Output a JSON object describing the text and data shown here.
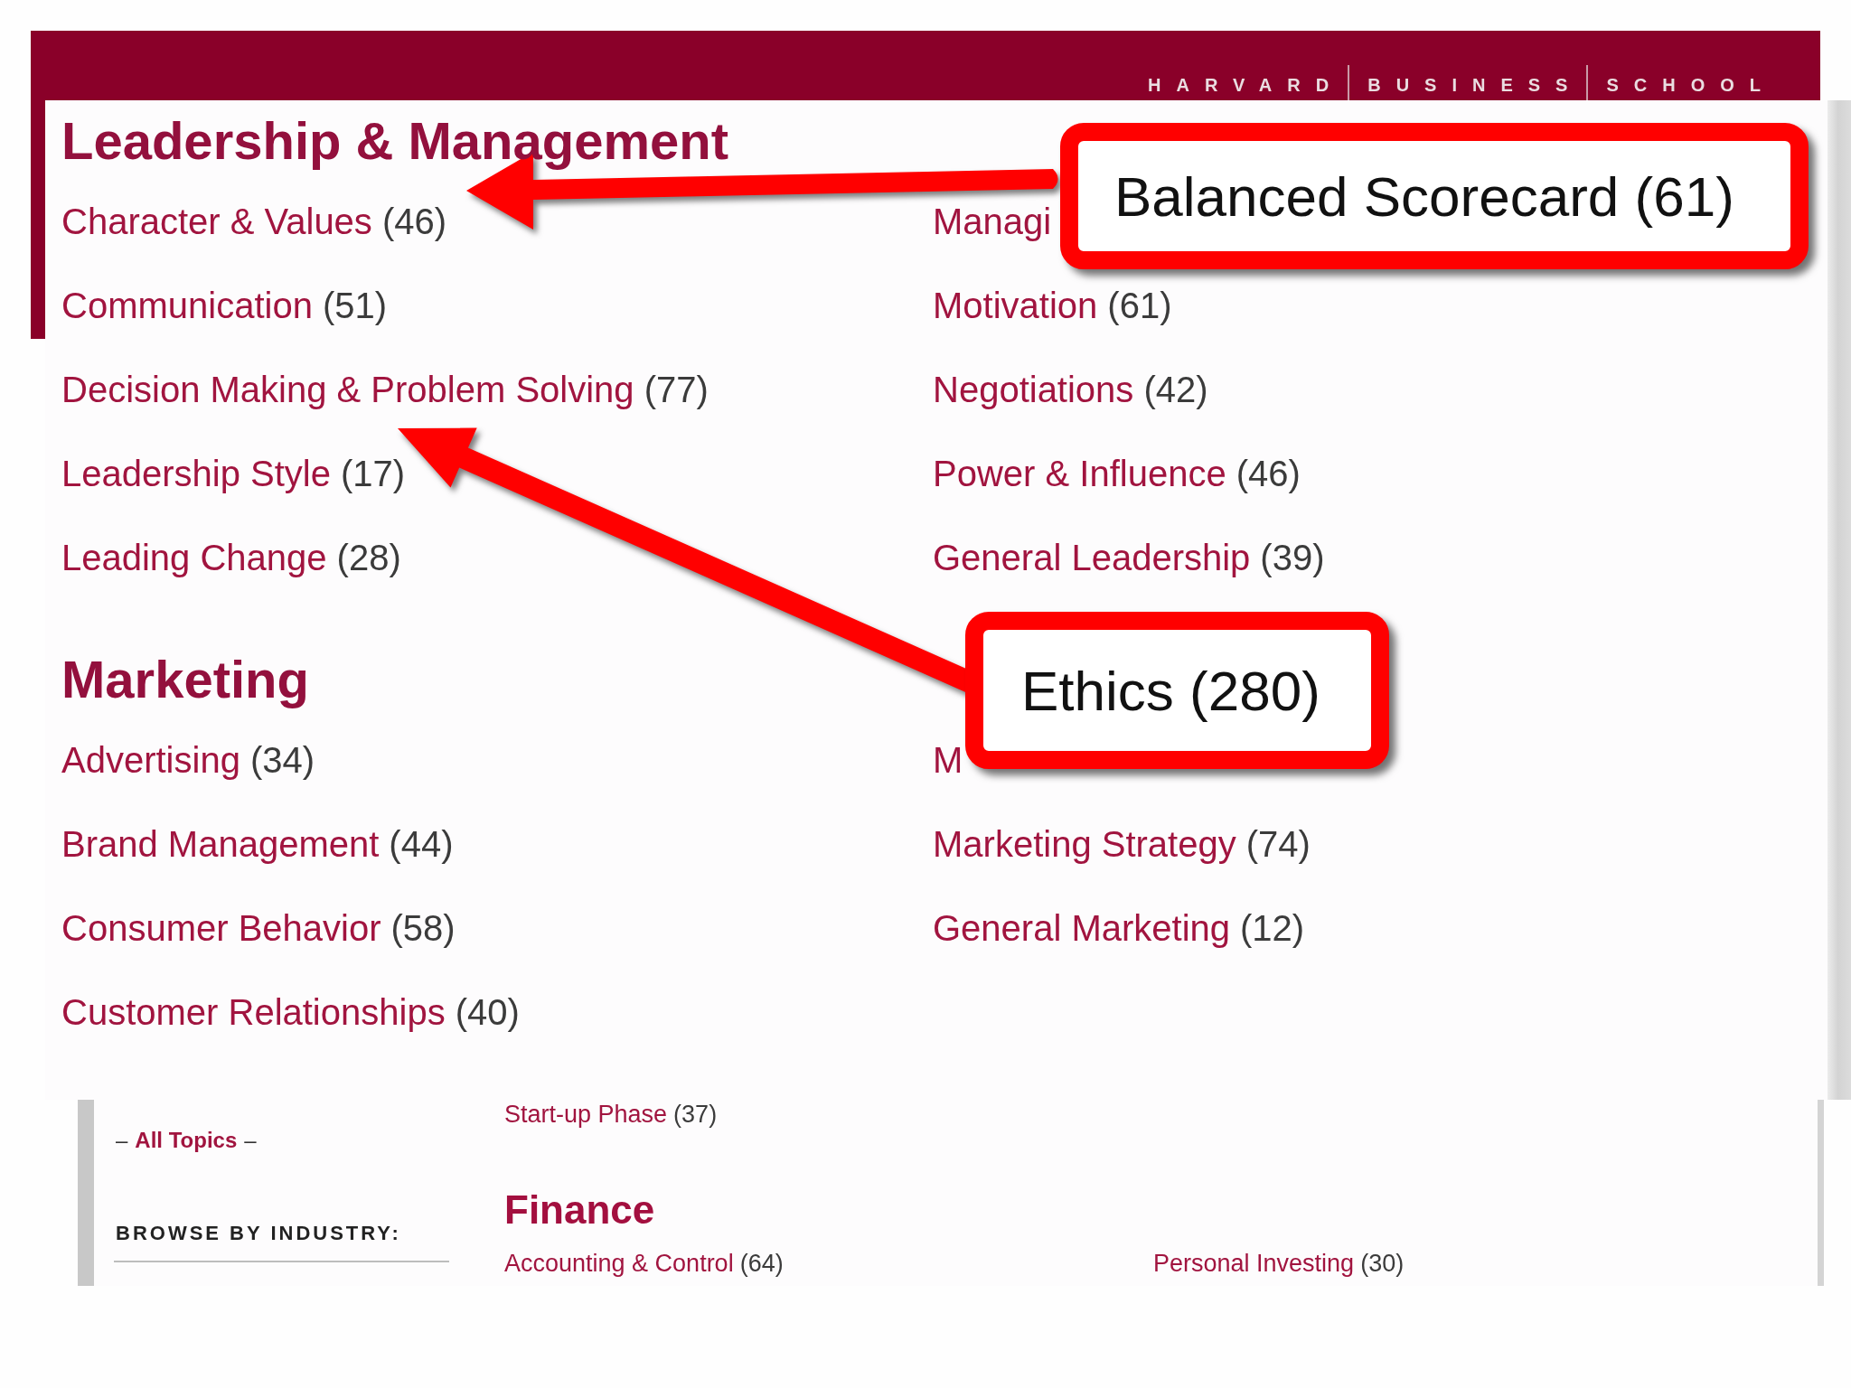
{
  "header": {
    "wordmark": [
      "HARVARD",
      "BUSINESS",
      "SCHOOL"
    ]
  },
  "sections": [
    {
      "title": "Leadership & Management",
      "columns": [
        [
          {
            "label": "Character & Values",
            "count": "(46)"
          },
          {
            "label": "Communication",
            "count": "(51)"
          },
          {
            "label": "Decision Making & Problem Solving",
            "count": "(77)"
          },
          {
            "label": "Leadership Style",
            "count": "(17)"
          },
          {
            "label": "Leading Change",
            "count": "(28)"
          }
        ],
        [
          {
            "label": "Managi"
          },
          {
            "label": "Motivation",
            "count": "(61)"
          },
          {
            "label": "Negotiations",
            "count": "(42)"
          },
          {
            "label": "Power & Influence",
            "count": "(46)"
          },
          {
            "label": "General Leadership",
            "count": "(39)"
          }
        ]
      ]
    },
    {
      "title": "Marketing",
      "columns": [
        [
          {
            "label": "Advertising",
            "count": "(34)"
          },
          {
            "label": "Brand Management",
            "count": "(44)"
          },
          {
            "label": "Consumer Behavior",
            "count": "(58)"
          },
          {
            "label": "Customer Relationships",
            "count": "(40)"
          }
        ],
        [
          {
            "label": "M"
          },
          {
            "label": "Marketing Strategy",
            "count": "(74)"
          },
          {
            "label": "General Marketing",
            "count": "(12)"
          }
        ]
      ]
    }
  ],
  "callouts": [
    {
      "text": "Balanced Scorecard (61)"
    },
    {
      "text": "Ethics (280)"
    }
  ],
  "lower_strip": {
    "sidebar": {
      "all_topics": {
        "before": "–",
        "link": "All Topics",
        "after": "–"
      },
      "browse_heading": "BROWSE BY INDUSTRY:"
    },
    "topics_above": [
      {
        "label": "Start-up Phase",
        "count": "(37)"
      }
    ],
    "sections": [
      {
        "title": "Finance",
        "columns": [
          [
            {
              "label": "Accounting & Control",
              "count": "(64)"
            }
          ],
          [
            {
              "label": "Personal Investing",
              "count": "(30)"
            }
          ]
        ]
      }
    ]
  }
}
